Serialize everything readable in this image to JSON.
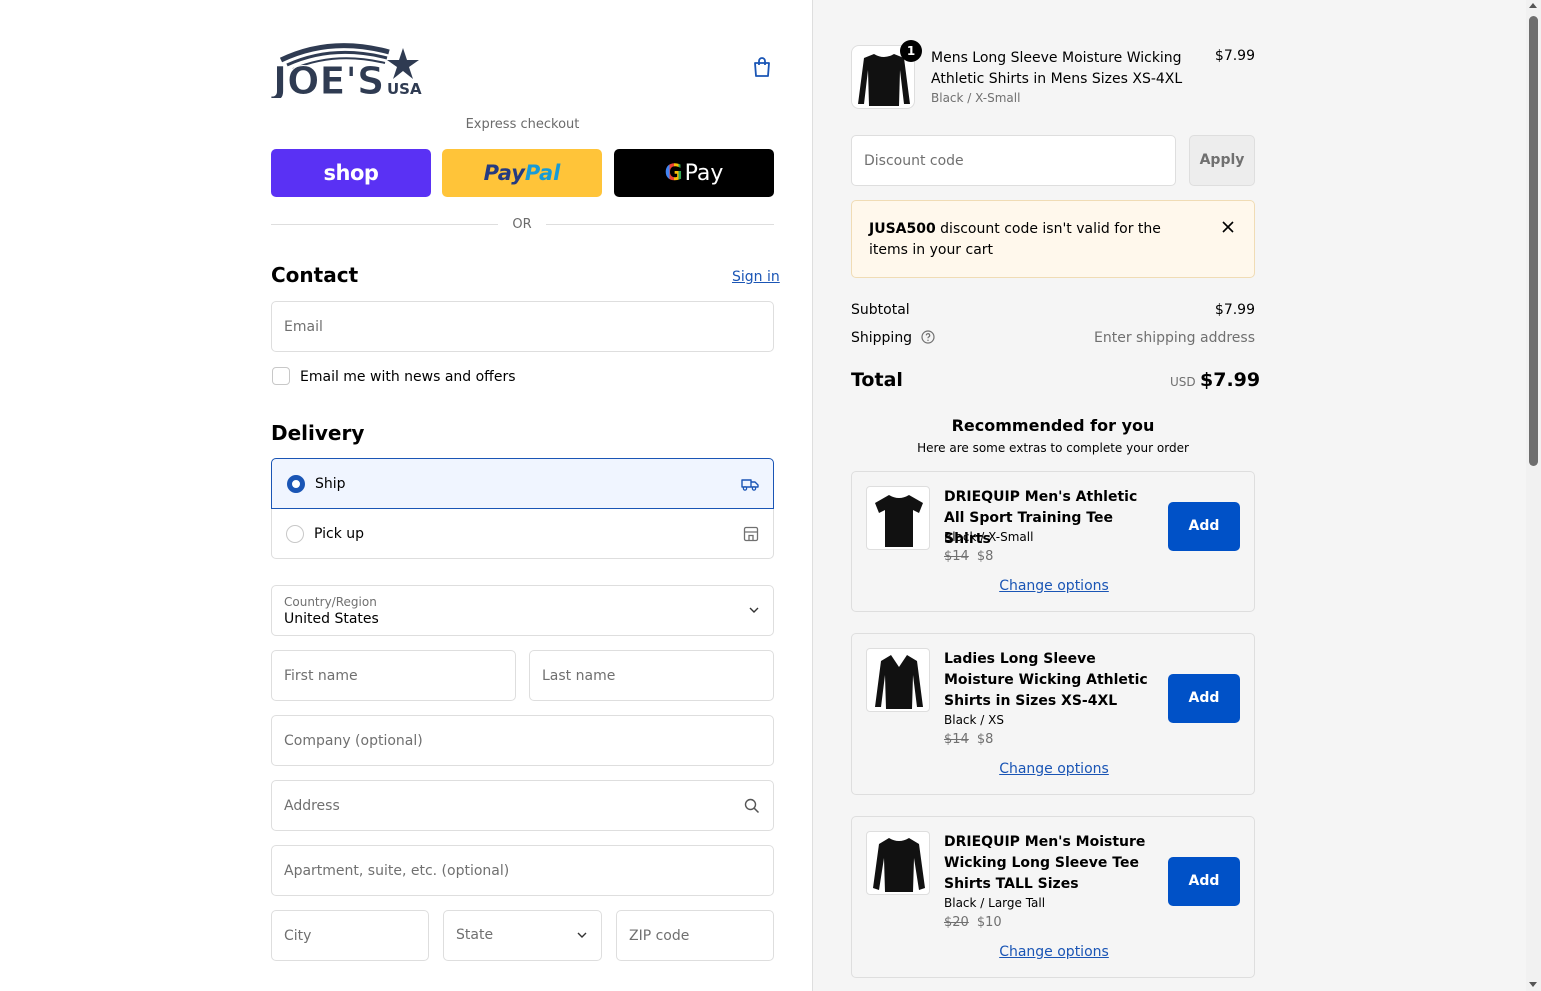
{
  "header": {
    "logo_text": "JOE'S",
    "logo_sub": "USA",
    "cart_icon": "shopping-bag-icon"
  },
  "express": {
    "title": "Express checkout",
    "shop_label": "shop",
    "paypal_label_1": "Pay",
    "paypal_label_2": "Pal",
    "gpay_g": "G",
    "gpay_label": "Pay",
    "or_text": "OR"
  },
  "contact": {
    "title": "Contact",
    "sign_in": "Sign in",
    "email_placeholder": "Email",
    "newsletter_label": "Email me with news and offers"
  },
  "delivery": {
    "title": "Delivery",
    "options": [
      {
        "label": "Ship",
        "icon": "truck-icon",
        "selected": true
      },
      {
        "label": "Pick up",
        "icon": "store-icon",
        "selected": false
      }
    ],
    "country_label": "Country/Region",
    "country_value": "United States",
    "first_name": "First name",
    "last_name": "Last name",
    "company": "Company (optional)",
    "address": "Address",
    "apartment": "Apartment, suite, etc. (optional)",
    "city": "City",
    "state": "State",
    "zip": "ZIP code"
  },
  "cart": {
    "item": {
      "quantity": "1",
      "title": "Mens Long Sleeve Moisture Wicking Athletic Shirts in Mens Sizes XS-4XL",
      "variant": "Black / X-Small",
      "price": "$7.99"
    },
    "discount_placeholder": "Discount code",
    "apply_label": "Apply",
    "alert_code": "JUSA500",
    "alert_text": " discount code isn't valid for the items in your cart",
    "subtotal_label": "Subtotal",
    "subtotal_value": "$7.99",
    "shipping_label": "Shipping",
    "shipping_value": "Enter shipping address",
    "total_label": "Total",
    "total_currency": "USD",
    "total_value": "$7.99"
  },
  "recommended": {
    "title": "Recommended for you",
    "subtitle": "Here are some extras to complete your order",
    "items": [
      {
        "name": "DRIEQUIP Men's Athletic All Sport Training Tee Shirts",
        "variant": "Black / X-Small",
        "old_price": "$14",
        "price": "$8",
        "add": "Add",
        "change": "Change options"
      },
      {
        "name": "Ladies Long Sleeve Moisture Wicking Athletic Shirts in Sizes XS-4XL",
        "variant": "Black / XS",
        "old_price": "$14",
        "price": "$8",
        "add": "Add",
        "change": "Change options"
      },
      {
        "name": "DRIEQUIP Men's Moisture Wicking Long Sleeve Tee Shirts TALL Sizes",
        "variant": "Black / Large Tall",
        "old_price": "$20",
        "price": "$10",
        "add": "Add",
        "change": "Change options"
      }
    ]
  },
  "colors": {
    "accent": "#1a55b5",
    "add_button": "#0051c7",
    "shop_pay": "#5a31f4",
    "paypal": "#ffc439",
    "alert_bg": "#fff8ec"
  }
}
